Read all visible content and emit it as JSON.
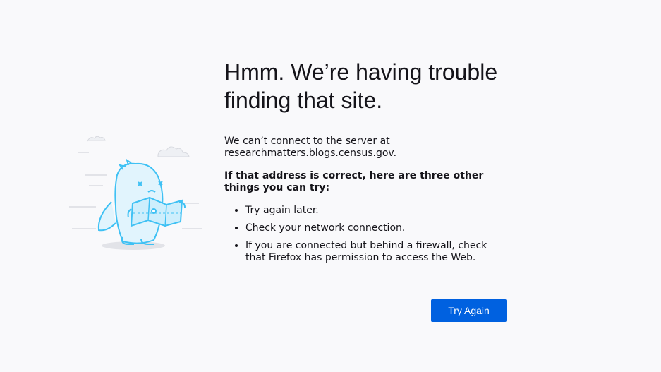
{
  "error": {
    "title": "Hmm. We’re having trouble finding that site.",
    "short_desc_line1": "We can’t connect to the server at",
    "short_desc_line2": "researchmatters.blogs.census.gov.",
    "long_desc_title": "If that address is correct, here are three other things you can try:",
    "suggestions": [
      "Try again later.",
      "Check your network connection.",
      "If you are connected but behind a firewall, check that Firefox has permission to access the Web."
    ]
  },
  "actions": {
    "try_again_label": "Try Again"
  },
  "colors": {
    "background": "#f9f9fb",
    "primary_button": "#0061e0",
    "illustration_blue": "#3fc1f4"
  },
  "icons": {
    "illustration": "lost-dino-with-map-illustration"
  }
}
